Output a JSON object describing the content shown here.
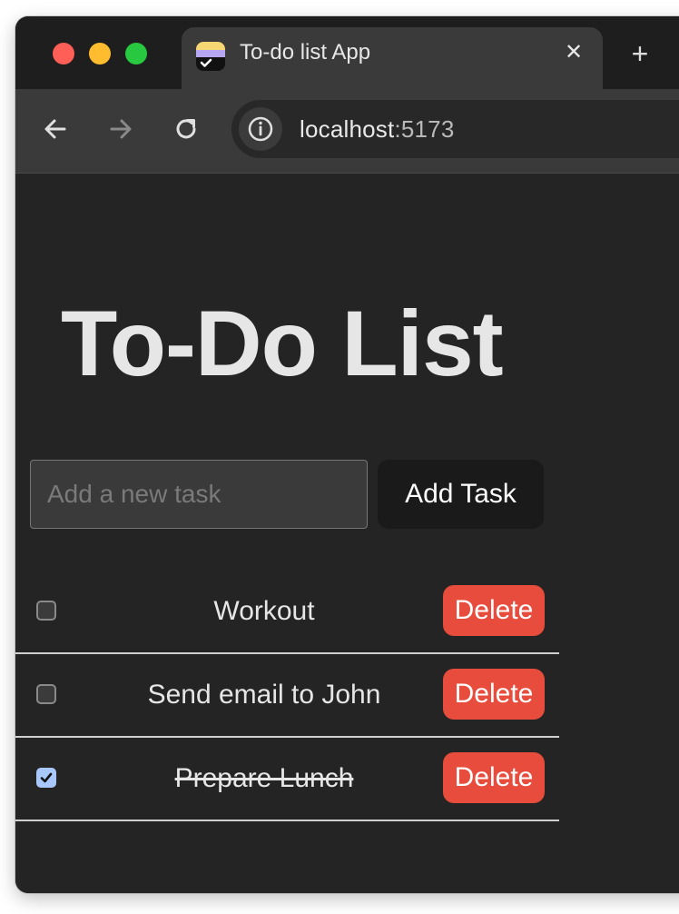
{
  "browser": {
    "tab_title": "To-do list App",
    "tab_close_glyph": "✕",
    "new_tab_glyph": "+",
    "url_host": "localhost",
    "url_port": ":5173"
  },
  "app": {
    "title": "To-Do List",
    "input_placeholder": "Add a new task",
    "input_value": "",
    "add_button_label": "Add Task",
    "tasks": [
      {
        "text": "Workout",
        "completed": false,
        "delete_label": "Delete"
      },
      {
        "text": "Send email to John",
        "completed": false,
        "delete_label": "Delete"
      },
      {
        "text": "Prepare Lunch",
        "completed": true,
        "delete_label": "Delete"
      }
    ]
  },
  "colors": {
    "page_bg": "#242424",
    "delete_button": "#e74c3c",
    "add_button": "#1a1a1a",
    "checkbox_checked": "#a8c7fa",
    "traffic_red": "#ff5f57",
    "traffic_yellow": "#febc2e",
    "traffic_green": "#28c840"
  },
  "icons": {
    "back": "arrow-left-icon",
    "forward": "arrow-right-icon",
    "reload": "reload-icon",
    "site_info": "info-icon",
    "favicon": "app-favicon",
    "close": "close-icon",
    "new_tab": "plus-icon",
    "check": "checkmark-icon"
  }
}
